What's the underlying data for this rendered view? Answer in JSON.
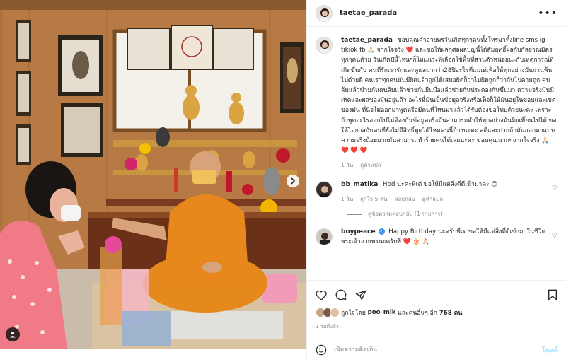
{
  "post": {
    "username": "taetae_parada",
    "more_icon": "more-horizontal-icon",
    "caption": "ขอบคุณคำอวยพรวันเกิดทุกๆคนทั้งโทรมาทั้งline sms ig tikiok fb 🙏🏻 จากใจจริง ❤️ และขอให้ผลกุศลผลบุญนี้ได้สัมฤทธิ์ผลกับกัลยาณมิตรทุกๆคนด้วย วันเกิดปีนี้ไหนๆก็ไหนแระพี่เลือกใช้พื้นที่ส่วนตัวหน่อยนะกับเหตุการณ์ที่เกิดขึ้นกับ คนที่รักเรารักและดูแลมากว่า28ปีอะไรที่แม่เต่เพ้อให้ทุกอย่างมันผ่านพ้นไปด้วยดี คนเราทุกคนมันมีผิดแล้วถูกได้เสมอผิดก็ว่าไปผิดถูกก็ว่ากันไปตามถูก คนล้มแล้วข้ามกันคนล้มแล้วช่วยกันยืนมือแล้วช่วยกันประคองกันขึ้นมา ความจริงมันมีเหตุและผลของมันอยู่แล้ว อะไรที่มันเป็นข้อมูลจริงหรือเท็จก็ให้มันอยู่ในขอบและเขตของมัน ที่นี่จไม่ออกมาพูดหรือมีคนที่ไหนมาแล้วได้รับต้องขอโทษด้วยนะคะ เพราะถ้าพูดอะไรออกไปไม่ต้องกันข้อมูลจริงมันสามารถทำให้ทุกอย่างมันผิดเพี้ยนไปได้ ขอให้โอกาสกับคนที่ยังไม่มีสิทธิ์พูดได้ไหมคนนี้บ้างนะคะ สติและปากถ้ามันออกมาแบบความจริงน้อยมากมันสามารถทำร้ายคนได้เลยนะคะ ขอบคุณมากๆจากใจจริง 🙏🏻 ❤️ ❤️ ❤️",
    "caption_time": "1 วัน",
    "caption_translate": "ดูคำแปล"
  },
  "comments": [
    {
      "username": "bb_matika",
      "text": "Hbd นะคะพี่เต่ ขอให้มีแต่สิ่งดีดีเข้ามาคะ 😊",
      "time": "1 วัน",
      "likes": "ถูกใจ 5 คน",
      "reply": "ตอบกลับ",
      "translate": "ดูคำแปล",
      "replies_label": "ดูข้อความตอบกลับ (1 รายการ)"
    },
    {
      "username": "boypeace",
      "text": "Happy Birthday นะครับพี่เต่ ขอให้มีแต่สิ่งที่ดีเข้ามาในชีวิต พระเจ้าอวยพรนะครับพี่ ❤️ 🎂 🙏🏻",
      "time": "",
      "likes": "",
      "reply": "",
      "translate": ""
    }
  ],
  "likes_summary": {
    "prefix": "ถูกใจโดย",
    "user": "poo_mik",
    "connector": "และคนอื่นๆ อีก",
    "count": "768 คน"
  },
  "date": "1 วันที่แล้ว",
  "add_comment": {
    "placeholder": "เพิ่มความคิดเห็น",
    "post_label": "โพสต์"
  },
  "icons": {
    "heart": "heart-icon",
    "comment": "comment-icon",
    "share": "share-icon",
    "save": "bookmark-icon",
    "emoji": "emoji-icon",
    "next": "chevron-right-icon",
    "tag": "user-tag-icon"
  },
  "colors": {
    "accent": "#3897f0",
    "post_disabled": "#b2dffc",
    "robe": "#e8881c",
    "wall": "#c58a52"
  }
}
